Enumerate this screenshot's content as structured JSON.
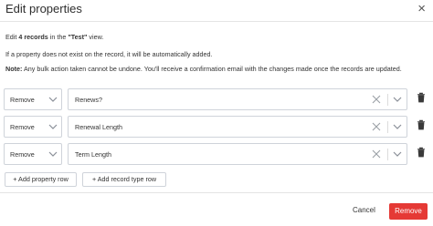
{
  "dialog": {
    "title": "Edit properties",
    "close_glyph": "×",
    "intro_prefix": "Edit ",
    "intro_count": "4 records",
    "intro_middle": " in the ",
    "intro_view": "\"Test\"",
    "intro_suffix": " view.",
    "info_text": "If a property does not exist on the record, it will be automatically added.",
    "note_label": "Note:",
    "note_text": " Any bulk action taken cannot be undone. You'll receive a confirmation email with the changes made once the records are updated."
  },
  "rows": [
    {
      "action": "Remove",
      "property": "Renews?"
    },
    {
      "action": "Remove",
      "property": "Renewal Length"
    },
    {
      "action": "Remove",
      "property": "Term Length"
    }
  ],
  "buttons": {
    "add_property_row": "+ Add property row",
    "add_record_type_row": "+ Add record type row"
  },
  "footer": {
    "cancel": "Cancel",
    "remove": "Remove"
  },
  "colors": {
    "primary_danger": "#e53935",
    "border": "#cfd3da"
  },
  "icons": [
    "close-icon",
    "chevron-down-icon",
    "clear-icon",
    "trash-icon"
  ]
}
